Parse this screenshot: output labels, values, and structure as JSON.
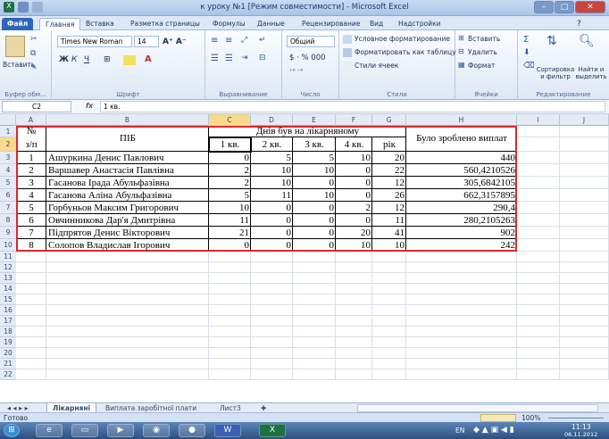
{
  "window": {
    "title": "к уроку №1  [Режим совместимости] - Microsoft Excel"
  },
  "tabs": [
    "Файл",
    "Главная",
    "Вставка",
    "Разметка страницы",
    "Формулы",
    "Данные",
    "Рецензирование",
    "Вид",
    "Надстройки"
  ],
  "ribbon": {
    "paste": "Вставить",
    "font_name": "Times New Roman",
    "font_size": "14",
    "number_format": "Общий",
    "cond_format": "Условное форматирование",
    "format_table": "Форматировать как таблицу",
    "cell_styles": "Стили ячеек",
    "insert": "Вставить",
    "delete": "Удалить",
    "format": "Формат",
    "sort_filter": "Сортировка и фильтр",
    "find_select": "Найти и выделить",
    "groups": {
      "clipboard": "Буфер обм...",
      "font": "Шрифт",
      "alignment": "Выравнивание",
      "number": "Число",
      "styles": "Стили",
      "cells": "Ячейки",
      "editing": "Редактирование"
    }
  },
  "formula_bar": {
    "name_box": "C2",
    "fx": "fx",
    "value": "1 кв."
  },
  "columns": [
    "A",
    "B",
    "C",
    "D",
    "E",
    "F",
    "G",
    "H",
    "I",
    "J"
  ],
  "rows": [
    "1",
    "2",
    "3",
    "4",
    "5",
    "6",
    "7",
    "8",
    "9",
    "10",
    "11",
    "12",
    "13",
    "14",
    "15",
    "16",
    "17",
    "18",
    "19",
    "20",
    "21",
    "22"
  ],
  "table": {
    "header_no": "№",
    "header_no2": "з/п",
    "header_name": "ПІБ",
    "header_days": "Днів був на лікарняному",
    "header_paid": "Було зроблено виплат",
    "quarters": [
      "1 кв.",
      "2 кв.",
      "3 кв.",
      "4 кв.",
      "рік"
    ],
    "data": [
      {
        "n": "1",
        "name": "Ашуркина Денис Павлович",
        "q1": "0",
        "q2": "5",
        "q3": "5",
        "q4": "10",
        "year": "20",
        "paid": "440"
      },
      {
        "n": "2",
        "name": "Варшавер Анастасія Павлівна",
        "q1": "2",
        "q2": "10",
        "q3": "10",
        "q4": "0",
        "year": "22",
        "paid": "560,4210526"
      },
      {
        "n": "3",
        "name": "Гасанова Ірада Абульфазівна",
        "q1": "2",
        "q2": "10",
        "q3": "0",
        "q4": "0",
        "year": "12",
        "paid": "305,6842105"
      },
      {
        "n": "4",
        "name": "Гасанова Аліна Абульфазівна",
        "q1": "5",
        "q2": "11",
        "q3": "10",
        "q4": "0",
        "year": "26",
        "paid": "662,3157895"
      },
      {
        "n": "5",
        "name": "Горбуньов Максим Григорович",
        "q1": "10",
        "q2": "0",
        "q3": "0",
        "q4": "2",
        "year": "12",
        "paid": "290,4"
      },
      {
        "n": "6",
        "name": "Овчинникова Дар'я Дмитрівна",
        "q1": "11",
        "q2": "0",
        "q3": "0",
        "q4": "0",
        "year": "11",
        "paid": "280,2105263"
      },
      {
        "n": "7",
        "name": "Підпрятов Денис Вікторович",
        "q1": "21",
        "q2": "0",
        "q3": "0",
        "q4": "20",
        "year": "41",
        "paid": "902"
      },
      {
        "n": "8",
        "name": "Солопов Владислав Ігорович",
        "q1": "0",
        "q2": "0",
        "q3": "0",
        "q4": "10",
        "year": "10",
        "paid": "242"
      }
    ]
  },
  "sheets": [
    "Лікарняні",
    "Виплата заробітної плати",
    "Лист3"
  ],
  "status": {
    "ready": "Готово",
    "zoom": "100%"
  },
  "taskbar": {
    "lang": "EN",
    "time": "11:13",
    "date": "06.11.2012"
  },
  "colors": {
    "red_border": "#d62b2b",
    "excel_green": "#1e7145"
  }
}
